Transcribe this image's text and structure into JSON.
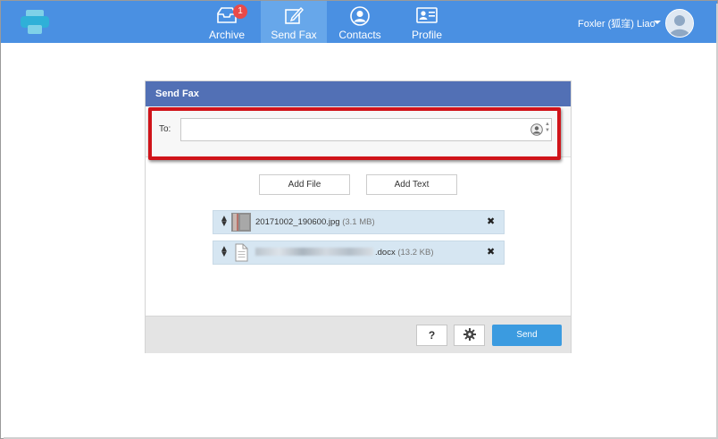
{
  "nav": {
    "items": [
      {
        "label": "Archive",
        "icon": "archive-tray-icon",
        "badge": "1"
      },
      {
        "label": "Send Fax",
        "icon": "compose-icon",
        "active": true
      },
      {
        "label": "Contacts",
        "icon": "contacts-person-icon"
      },
      {
        "label": "Profile",
        "icon": "profile-card-icon"
      }
    ],
    "user_name": "Foxler (狐窪) Liao"
  },
  "panel": {
    "title": "Send Fax",
    "to_label": "To:",
    "to_value": "",
    "add_file_label": "Add File",
    "add_text_label": "Add Text",
    "files": [
      {
        "name": "20171002_190600.jpg",
        "size": "(3.1 MB)",
        "type": "image"
      },
      {
        "name_suffix": ".docx",
        "size": "(13.2 KB)",
        "type": "document"
      }
    ],
    "help_label": "?",
    "send_label": "Send"
  },
  "colors": {
    "nav_bg": "#4a90e2",
    "nav_active": "#67a7ea",
    "panel_header": "#5270b5",
    "highlight": "#d0141a",
    "send_button": "#3b9be0",
    "file_row": "#d6e6f2"
  }
}
